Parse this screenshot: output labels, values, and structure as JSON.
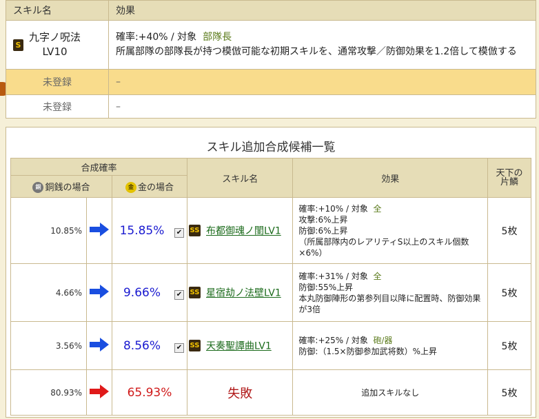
{
  "top": {
    "headers": {
      "name": "スキル名",
      "effect": "効果"
    },
    "current": {
      "rank": "S",
      "name": "九字ノ呪法",
      "level": "LV10",
      "effect_prob": "確率:+40% / 対象",
      "effect_target": "部隊長",
      "effect_desc": "所属部隊の部隊長が持つ模倣可能な初期スキルを、通常攻撃／防御効果を1.2倍して模倣する"
    },
    "slot2": {
      "name": "未登録",
      "effect": "–"
    },
    "slot3": {
      "name": "未登録",
      "effect": "–"
    }
  },
  "panel": {
    "title": "スキル追加合成候補一覧",
    "headers": {
      "prob": "合成確率",
      "copper": "銅銭の場合",
      "gold": "金の場合",
      "skill": "スキル名",
      "effect": "効果",
      "scale_l1": "天下の",
      "scale_l2": "片鱗"
    },
    "coin_cu": "銅",
    "coin_au": "金",
    "rows": [
      {
        "copper": "10.85%",
        "gold": "15.85%",
        "rank": "SS",
        "skill": "布都御魂ノ閨LV1",
        "e1a": "確率:+10% / 対象",
        "e1b": "全",
        "e2": "攻撃:6%上昇",
        "e3": "防御:6%上昇",
        "e4": "（所属部隊内のレアリティS以上のスキル個数×6%）",
        "count": "5枚"
      },
      {
        "copper": "4.66%",
        "gold": "9.66%",
        "rank": "SS",
        "skill": "星宿劫ノ法壁LV1",
        "e1a": "確率:+31% / 対象",
        "e1b": "全",
        "e2": "防御:55%上昇",
        "e3": "本丸防御陣形の第参列目以降に配置時、防御効果が3倍",
        "count": "5枚"
      },
      {
        "copper": "3.56%",
        "gold": "8.56%",
        "rank": "SS",
        "skill": "天奏聖譚曲LV1",
        "e1a": "確率:+25% / 対象",
        "e1b": "砲/器",
        "e2": "防御:（1.5×防御参加武将数）%上昇",
        "count": "5枚"
      },
      {
        "copper": "80.93%",
        "gold": "65.93%",
        "fail": "失敗",
        "effect": "追加スキルなし",
        "count": "5枚"
      }
    ],
    "colors": {
      "arrow_blue": "#1a4ee0",
      "arrow_red": "#e01a1a"
    },
    "checkbox_mark": "✔"
  }
}
